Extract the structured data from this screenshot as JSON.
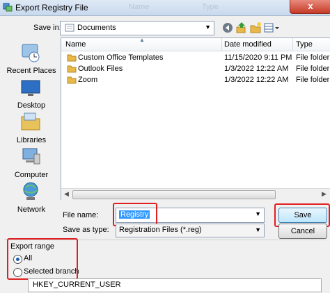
{
  "window": {
    "title": "Export Registry File",
    "close_glyph": "x",
    "ghost_headers": [
      "Name",
      "Type"
    ]
  },
  "save_in": {
    "label": "Save in:",
    "value": "Documents"
  },
  "places": [
    {
      "label": "Recent Places",
      "icon": "recent-places-icon"
    },
    {
      "label": "Desktop",
      "icon": "desktop-icon"
    },
    {
      "label": "Libraries",
      "icon": "libraries-icon"
    },
    {
      "label": "Computer",
      "icon": "computer-icon"
    },
    {
      "label": "Network",
      "icon": "network-icon"
    }
  ],
  "file_list": {
    "columns": [
      "Name",
      "Date modified",
      "Type"
    ],
    "rows": [
      {
        "name": "Custom Office Templates",
        "date": "11/15/2020 9:11 PM",
        "type": "File folder"
      },
      {
        "name": "Outlook Files",
        "date": "1/3/2022 12:22 AM",
        "type": "File folder"
      },
      {
        "name": "Zoom",
        "date": "1/3/2022 12:22 AM",
        "type": "File folder"
      }
    ]
  },
  "file_name": {
    "label": "File name:",
    "value": "Registry"
  },
  "save_as_type": {
    "label": "Save as type:",
    "value": "Registration Files (*.reg)"
  },
  "buttons": {
    "save": "Save",
    "cancel": "Cancel"
  },
  "export_range": {
    "label": "Export range",
    "options": [
      {
        "label": "All",
        "selected": true
      },
      {
        "label": "Selected branch",
        "selected": false
      }
    ],
    "branch_value": "HKEY_CURRENT_USER"
  },
  "colors": {
    "highlight_box": "#e02020",
    "selection": "#3399ff",
    "folder": "#e8b84a"
  }
}
